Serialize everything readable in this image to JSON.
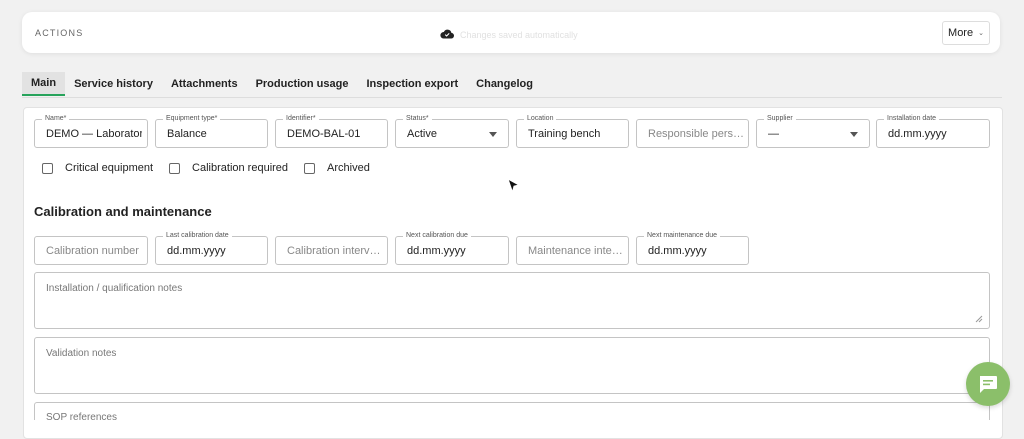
{
  "actions": {
    "label": "ACTIONS",
    "saved_status": "Changes saved automatically",
    "more_label": "More"
  },
  "tabs": [
    {
      "label": "Main",
      "active": true
    },
    {
      "label": "Service history"
    },
    {
      "label": "Attachments"
    },
    {
      "label": "Production usage"
    },
    {
      "label": "Inspection export"
    },
    {
      "label": "Changelog"
    }
  ],
  "fields": {
    "name": {
      "label": "Name*",
      "value": "DEMO — Laborator"
    },
    "equipment_type": {
      "label": "Equipment type*",
      "value": "Balance"
    },
    "identifier": {
      "label": "Identifier*",
      "value": "DEMO-BAL-01"
    },
    "status": {
      "label": "Status*",
      "value": "Active"
    },
    "location": {
      "label": "Location",
      "value": "Training bench"
    },
    "responsible_person": {
      "placeholder": "Responsible person"
    },
    "supplier": {
      "label": "Supplier",
      "value": "—"
    },
    "installation_date": {
      "label": "Installation date",
      "value": "dd.mm.yyyy"
    }
  },
  "checkboxes": [
    {
      "label": "Critical equipment",
      "checked": false
    },
    {
      "label": "Calibration required",
      "checked": false
    },
    {
      "label": "Archived",
      "checked": false
    }
  ],
  "calibration": {
    "title": "Calibration and maintenance",
    "calibration_number": {
      "placeholder": "Calibration number"
    },
    "last_calibration": {
      "label": "Last calibration date",
      "value": "dd.mm.yyyy"
    },
    "calibration_interval": {
      "placeholder": "Calibration interval..."
    },
    "next_calibration": {
      "label": "Next calibration due",
      "value": "dd.mm.yyyy"
    },
    "maintenance_interval": {
      "placeholder": "Maintenance interv..."
    },
    "next_maintenance": {
      "label": "Next maintenance due",
      "value": "dd.mm.yyyy"
    }
  },
  "notes": {
    "installation": "Installation / qualification notes",
    "validation": "Validation notes",
    "sop": "SOP references"
  },
  "colors": {
    "accent": "#27a35b",
    "chat_button": "#8bbf6a"
  }
}
